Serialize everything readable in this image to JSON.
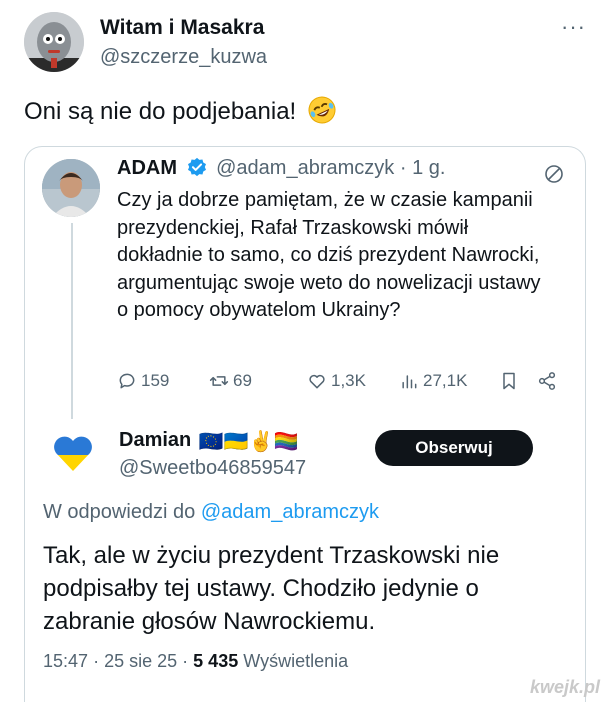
{
  "post": {
    "author_name": "Witam i Masakra",
    "author_handle": "@szczerze_kuzwa",
    "more_label": "···",
    "text": "Oni są nie do podjebania!",
    "emoji_icon": "rofl-emoji"
  },
  "quoted": {
    "name": "ADAM",
    "handle": "@adam_abramczyk",
    "separator": "·",
    "time": "1 g.",
    "text": "Czy ja dobrze pamiętam, że w czasie kampanii prezydenckiej, Rafał Trzaskowski mówił dokładnie to samo, co dziś prezydent Nawrocki, argumentując swoje weto do nowelizacji ustawy o pomocy obywatelom Ukrainy?",
    "actions": {
      "replies": "159",
      "reposts": "69",
      "likes": "1,3K",
      "views": "27,1K"
    }
  },
  "reply": {
    "name": "Damian",
    "flags": "🇪🇺🇺🇦✌️🏳️‍🌈",
    "handle": "@Sweetbo46859547",
    "follow_label": "Obserwuj",
    "in_reply_prefix": "W odpowiedzi do",
    "in_reply_mention": "@adam_abramczyk",
    "text": "Tak, ale w życiu prezydent Trzaskowski nie podpisałby tej ustawy. Chodziło jedynie o zabranie głosów Nawrockiemu.",
    "time": "15:47",
    "date": "25 sie 25",
    "dot": "·",
    "views_count": "5 435",
    "views_label": "Wyświetlenia"
  },
  "watermark": "kwejk.pl",
  "colors": {
    "accent": "#1d9bf0",
    "text": "#0f1419",
    "muted": "#536471",
    "border": "#cfd9de",
    "button": "#0f1419"
  }
}
